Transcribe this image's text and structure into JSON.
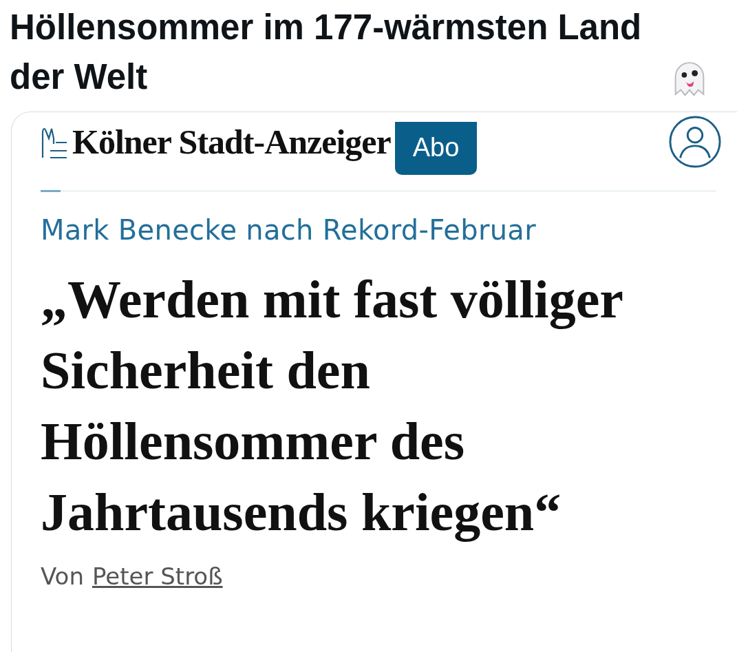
{
  "post": {
    "text": "Höllensommer im 177-wärmsten Land der Welt"
  },
  "article": {
    "masthead": "Kölner Stadt-Anzeiger",
    "subscribe_button": "Abo",
    "reading_progress": {
      "level": 0.03
    },
    "kicker": "Mark Benecke nach Rekord-Februar",
    "headline": "„Werden mit fast völliger Sicherheit den Höllensommer des Jahrtausends kriegen“",
    "byline_prefix": "Von",
    "author": "Peter Stroß"
  }
}
